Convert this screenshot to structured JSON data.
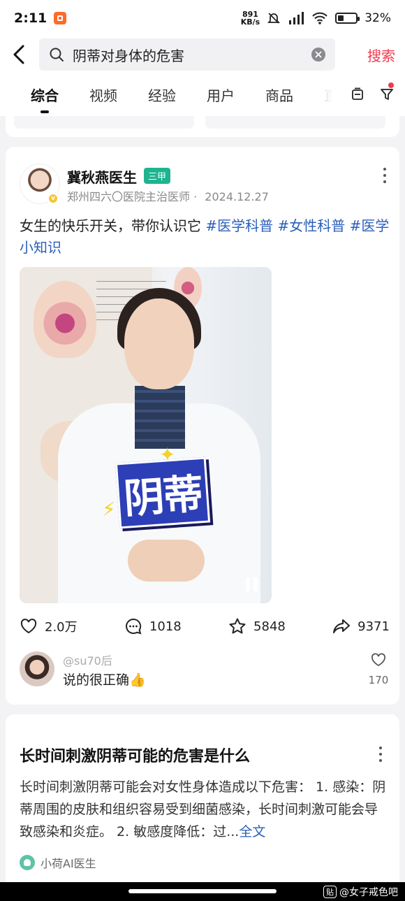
{
  "status_bar": {
    "time": "2:11",
    "net_speed": "891",
    "net_unit": "KB/s",
    "battery": "32%"
  },
  "search": {
    "query": "阴蒂对身体的危害",
    "button": "搜索"
  },
  "tabs": [
    "综合",
    "视频",
    "经验",
    "用户",
    "商品",
    "直"
  ],
  "post": {
    "author": "冀秋燕医生",
    "badge": "三甲",
    "affiliation": "郑州四六〇医院主治医师",
    "separator": "·",
    "date": "2024.12.27",
    "text": "女生的快乐开关，带你认识它 ",
    "hashtags": [
      "#医学科普",
      "#女性科普",
      "#医学小知识"
    ],
    "video_overlay_text": "阴蒂",
    "likes": "2.0万",
    "comments": "1018",
    "favorites": "5848",
    "shares": "9371",
    "top_comment": {
      "user": "@su70后",
      "text": "说的很正确👍",
      "likes": "170"
    }
  },
  "answer": {
    "title": "长时间刺激阴蒂可能的危害是什么",
    "body": "长时间刺激阴蒂可能会对女性身体造成以下危害： 1. 感染：阴蒂周围的皮肤和组织容易受到细菌感染，长时间刺激可能会导致感染和炎症。 2. 敏感度降低：过...",
    "more_link": "全文",
    "source": "小荷AI医生"
  },
  "watermark": "@女子戒色吧",
  "watermark_logo": "贴"
}
